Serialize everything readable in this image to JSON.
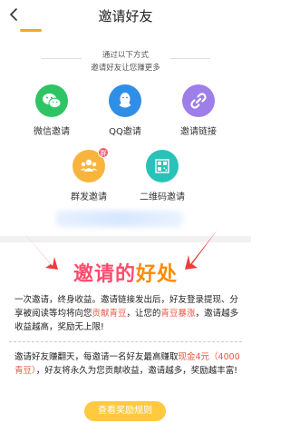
{
  "header": {
    "title": "邀请好友"
  },
  "intro": {
    "line1": "通过以下方式",
    "line2": "邀请好友让您赚更多"
  },
  "options": [
    {
      "label": "微信邀请",
      "color": "#2fc463",
      "icon": "wechat-icon"
    },
    {
      "label": "QQ邀请",
      "color": "#2f8ee8",
      "icon": "qq-icon"
    },
    {
      "label": "邀请链接",
      "color": "#9e7ee8",
      "icon": "link-icon"
    },
    {
      "label": "群发邀请",
      "color": "#f8b43c",
      "icon": "group-icon",
      "badge": "群"
    },
    {
      "label": "二维码邀请",
      "color": "#28c2b8",
      "icon": "qrcode-icon"
    }
  ],
  "benefits": {
    "title_part1": "邀请的",
    "title_part2": "好处",
    "p1_a": "一次邀请，终身收益。邀请链接发出后，好友登录提现、分享被阅读等均将向您",
    "p1_red1": "贡献青豆",
    "p1_b": "，让您的",
    "p1_red2": "青豆暴涨",
    "p1_c": "，邀请越多收益越高，奖励无上限!",
    "p2_a": "邀请好友赚翻天，每邀请一名好友最高赚取",
    "p2_red": "现金4元（4000青豆）",
    "p2_b": "，好友将永久为您贡献收益，邀请越多，奖励越丰富!"
  },
  "rules_button": "查看奖励规则"
}
